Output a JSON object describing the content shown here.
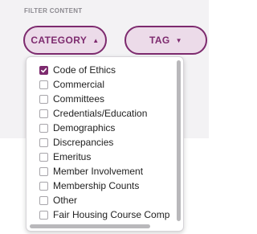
{
  "filter": {
    "heading": "FILTER CONTENT",
    "category_button": {
      "label": "CATEGORY",
      "caret": "▲",
      "expanded": true
    },
    "tag_button": {
      "label": "TAG",
      "caret": "▼",
      "expanded": false
    }
  },
  "dropdown": {
    "options": [
      {
        "label": "Code of Ethics",
        "checked": true
      },
      {
        "label": "Commercial",
        "checked": false
      },
      {
        "label": "Committees",
        "checked": false
      },
      {
        "label": "Credentials/Education",
        "checked": false
      },
      {
        "label": "Demographics",
        "checked": false
      },
      {
        "label": "Discrepancies",
        "checked": false
      },
      {
        "label": "Emeritus",
        "checked": false
      },
      {
        "label": "Member Involvement",
        "checked": false
      },
      {
        "label": "Membership Counts",
        "checked": false
      },
      {
        "label": "Other",
        "checked": false
      },
      {
        "label": "Fair Housing Course Comp",
        "checked": false
      }
    ]
  },
  "colors": {
    "accent": "#7d2a6e",
    "pill_background": "#ecdbe9",
    "panel_background": "#f3f2f4"
  }
}
